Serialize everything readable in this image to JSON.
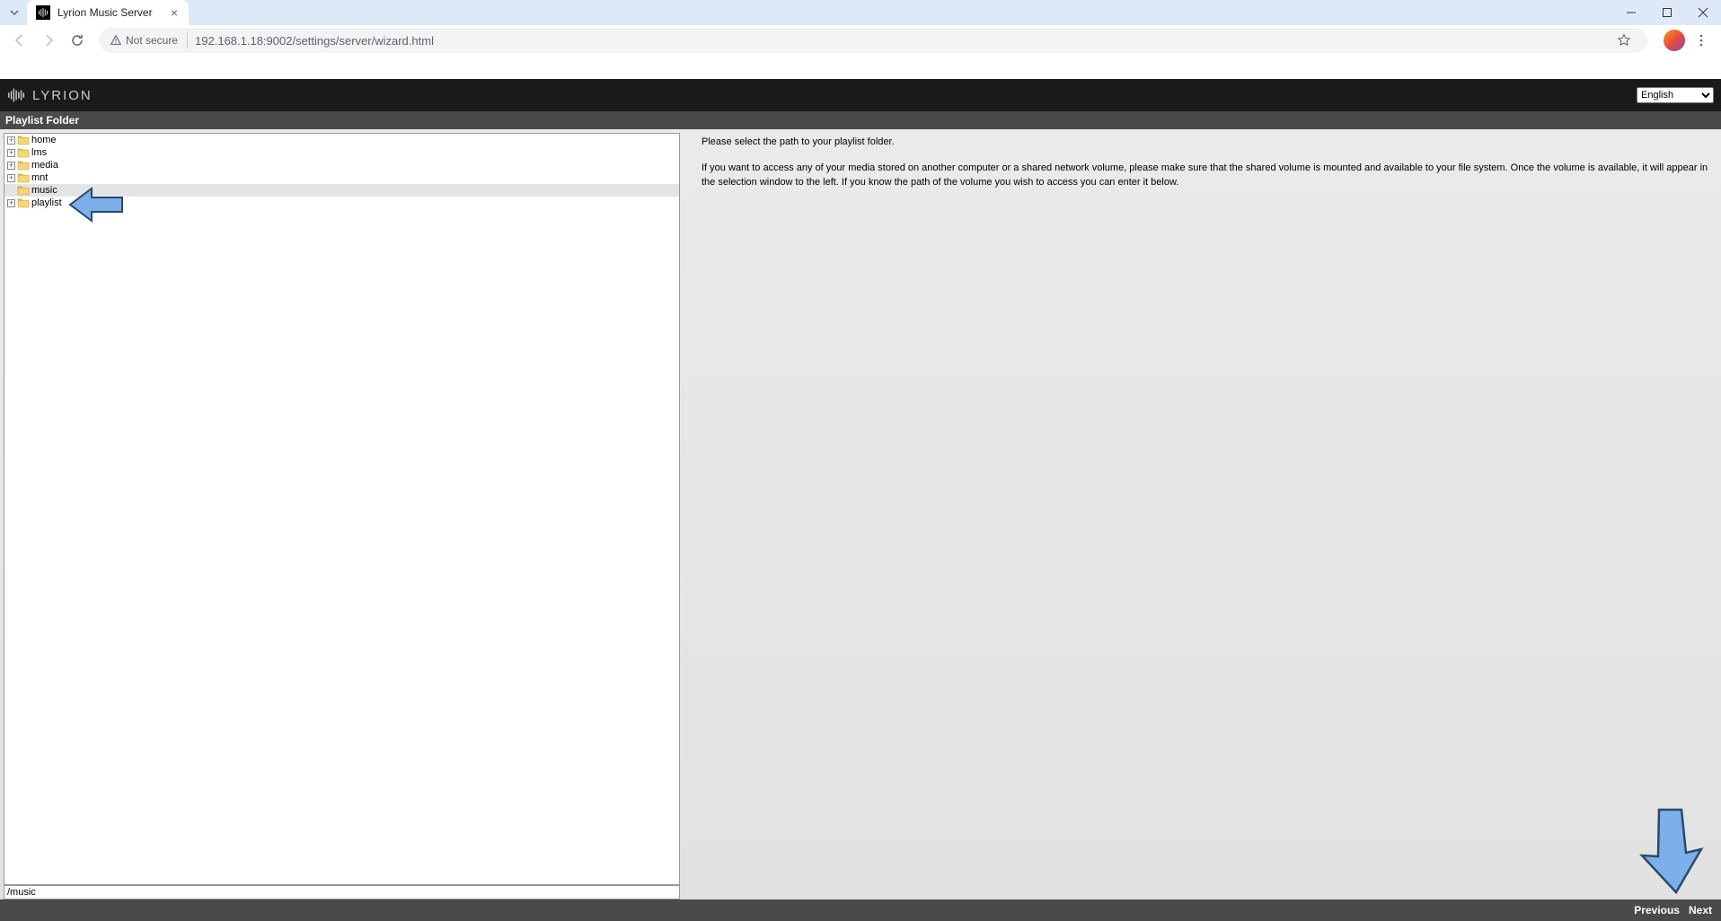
{
  "browser": {
    "tab_title": "Lyrion Music Server",
    "security_label": "Not secure",
    "url": "192.168.1.18:9002/settings/server/wizard.html"
  },
  "app": {
    "brand": "LYRION",
    "language_selected": "English"
  },
  "section": {
    "title": "Playlist Folder"
  },
  "tree": {
    "nodes": [
      {
        "label": "home",
        "expandable": true,
        "selected": false
      },
      {
        "label": "lms",
        "expandable": true,
        "selected": false
      },
      {
        "label": "media",
        "expandable": true,
        "selected": false
      },
      {
        "label": "mnt",
        "expandable": true,
        "selected": false
      },
      {
        "label": "music",
        "expandable": false,
        "selected": true
      },
      {
        "label": "playlist",
        "expandable": true,
        "selected": false
      }
    ],
    "path_value": "/music"
  },
  "instructions": {
    "line1": "Please select the path to your playlist folder.",
    "line2": "If you want to access any of your media stored on another computer or a shared network volume, please make sure that the shared volume is mounted and available to your file system. Once the volume is available, it will appear in the selection window to the left. If you know the path of the volume you wish to access you can enter it below."
  },
  "footer": {
    "previous": "Previous",
    "next": "Next"
  }
}
